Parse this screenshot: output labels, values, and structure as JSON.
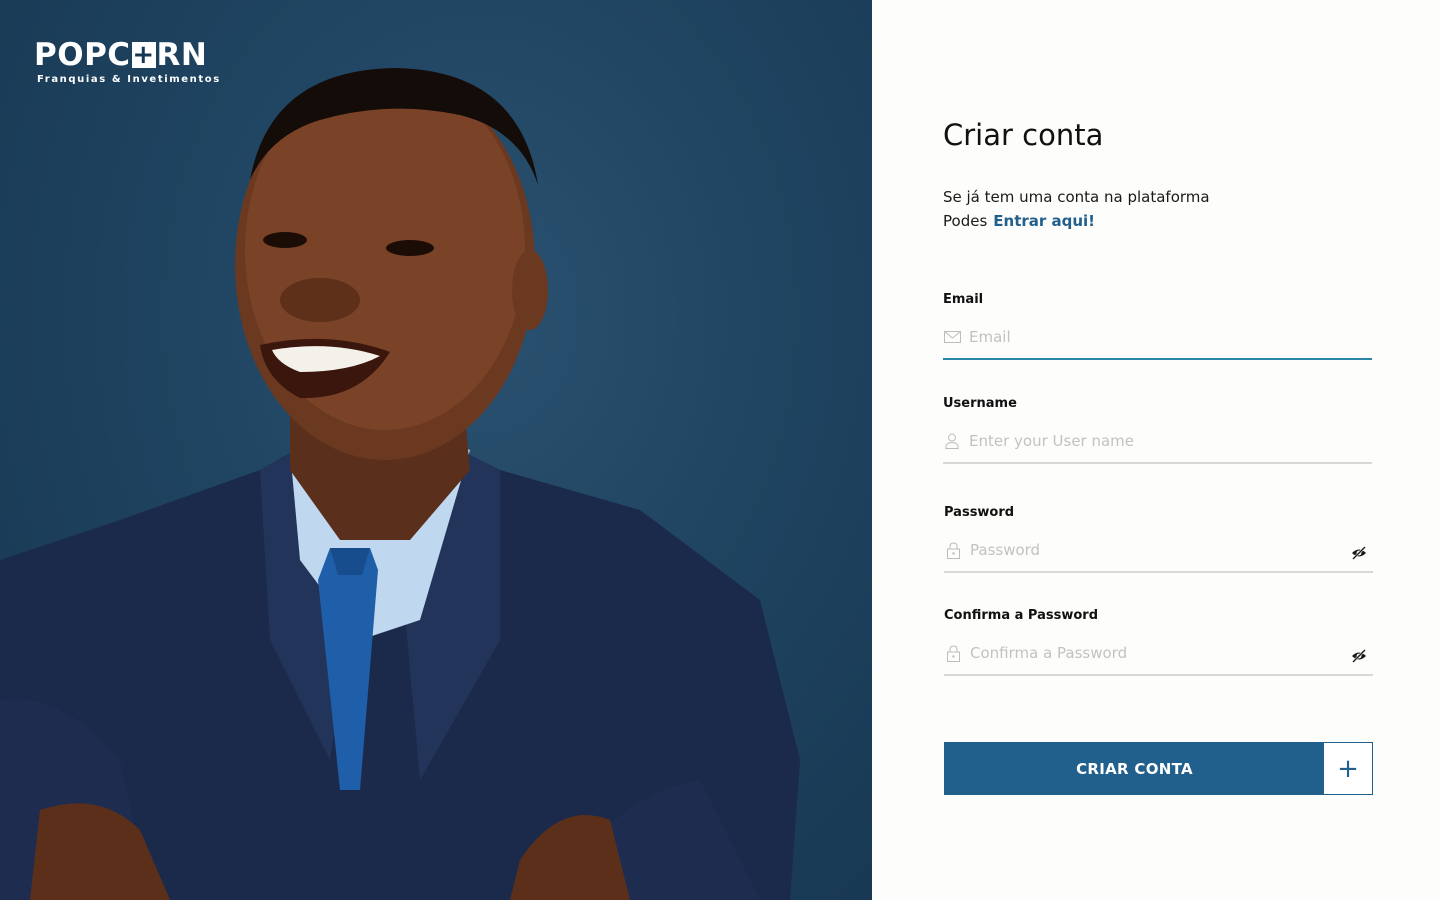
{
  "brand": {
    "name_left": "POPC",
    "name_box": "+",
    "name_right": "RN",
    "tagline": "Franquias & Invetimentos"
  },
  "form": {
    "title": "Criar conta",
    "intro_line1": "Se já tem uma conta na plataforma",
    "intro_line2": "Podes",
    "login_link": "Entrar aqui!",
    "email": {
      "label": "Email",
      "placeholder": "Email",
      "value": ""
    },
    "username": {
      "label": "Username",
      "placeholder": "Enter your User name",
      "value": ""
    },
    "password": {
      "label": "Password",
      "placeholder": "Password",
      "value": ""
    },
    "confirm": {
      "label": "Confirma a Password",
      "placeholder": "Confirma a Password",
      "value": ""
    },
    "submit_label": "CRIAR CONTA",
    "submit_icon": "+"
  },
  "icons": {
    "email": "envelope-icon",
    "username": "user-icon",
    "password": "lock-icon",
    "toggle": "eye-off-icon"
  },
  "colors": {
    "primary": "#215f8c",
    "active_underline": "#2a86a8",
    "hero_bg": "#1f4461"
  }
}
